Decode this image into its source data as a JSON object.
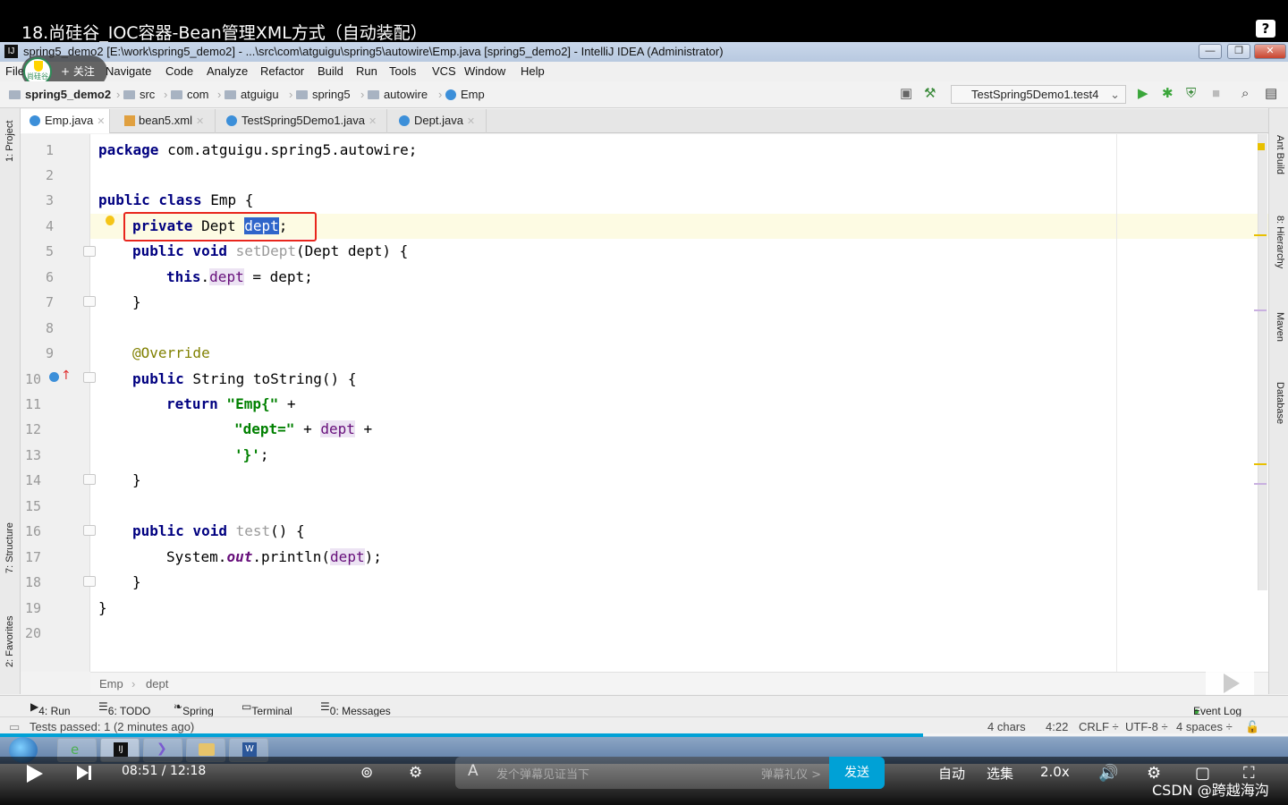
{
  "video": {
    "title": "18.尚硅谷_IOC容器-Bean管理XML方式（自动装配）",
    "help": "?"
  },
  "window": {
    "title": "spring5_demo2 [E:\\work\\spring5_demo2] - ...\\src\\com\\atguigu\\spring5\\autowire\\Emp.java [spring5_demo2] - IntelliJ IDEA (Administrator)",
    "ij": "IJ",
    "min": "—",
    "max": "❐",
    "close": "✕"
  },
  "uploader": {
    "follow": "+ 关注",
    "logo_text": "尚硅谷"
  },
  "menu": [
    "File",
    "Navigate",
    "Code",
    "Analyze",
    "Refactor",
    "Build",
    "Run",
    "Tools",
    "VCS",
    "Window",
    "Help"
  ],
  "breadcrumb": [
    "spring5_demo2",
    "src",
    "com",
    "atguigu",
    "spring5",
    "autowire",
    "Emp"
  ],
  "run_config": "TestSpring5Demo1.test4",
  "tabs": [
    {
      "label": "Emp.java",
      "active": true
    },
    {
      "label": "bean5.xml",
      "active": false
    },
    {
      "label": "TestSpring5Demo1.java",
      "active": false
    },
    {
      "label": "Dept.java",
      "active": false
    }
  ],
  "left_tools": [
    "1: Project",
    "7: Structure",
    "2: Favorites"
  ],
  "right_tools": [
    "Ant Build",
    "8: Hierarchy",
    "Maven",
    "Database"
  ],
  "code": {
    "line_numbers": [
      "1",
      "2",
      "3",
      "4",
      "5",
      "6",
      "7",
      "8",
      "9",
      "10",
      "11",
      "12",
      "13",
      "14",
      "15",
      "16",
      "17",
      "18",
      "19",
      "20"
    ],
    "l1_kw": "package",
    "l1_rest": " com.atguigu.spring5.autowire;",
    "l3_kw": "public class",
    "l3_rest": " Emp {",
    "l4_kw": "private",
    "l4_type": " Dept ",
    "l4_sel": "dept",
    "l4_end": ";",
    "l5_kw": "public void",
    "l5_name": " setDept",
    "l5_rest": "(Dept dept) {",
    "l6_kw": "this",
    "l6_dot": ".",
    "l6_fld": "dept",
    "l6_rest": " = dept;",
    "l7": "}",
    "l9": "@Override",
    "l10_kw": "public",
    "l10_rest": " String toString() {",
    "l11_kw": "return",
    "l11_str": " \"Emp{\"",
    "l11_rest": " +",
    "l12_str": "\"dept=\"",
    "l12_mid": " + ",
    "l12_fld": "dept",
    "l12_rest": " +",
    "l13_str": "'}'",
    "l13_rest": ";",
    "l14": "}",
    "l16_kw": "public void",
    "l16_name": " test",
    "l16_rest": "() {",
    "l17_a": "System.",
    "l17_out": "out",
    "l17_b": ".println(",
    "l17_fld": "dept",
    "l17_c": ");",
    "l18": "}",
    "l19": "}"
  },
  "editor_crumb": [
    "Emp",
    "dept"
  ],
  "toolwindows": [
    "4: Run",
    "6: TODO",
    "Spring",
    "Terminal",
    "0: Messages",
    "Event Log"
  ],
  "status": {
    "message": "Tests passed: 1 (2 minutes ago)",
    "chars": "4 chars",
    "pos": "4:22",
    "crlf": "CRLF ÷",
    "enc": "UTF-8 ÷",
    "indent": "4 spaces ÷"
  },
  "player": {
    "time": "08:51 / 12:18",
    "danmaku_placeholder": "发个弹幕见证当下",
    "gift": "弹幕礼仪 >",
    "send": "发送",
    "auto": "自动",
    "episodes": "选集",
    "speed": "2.0x",
    "progress": 0.717
  },
  "watermark": "CSDN @跨越海沟"
}
